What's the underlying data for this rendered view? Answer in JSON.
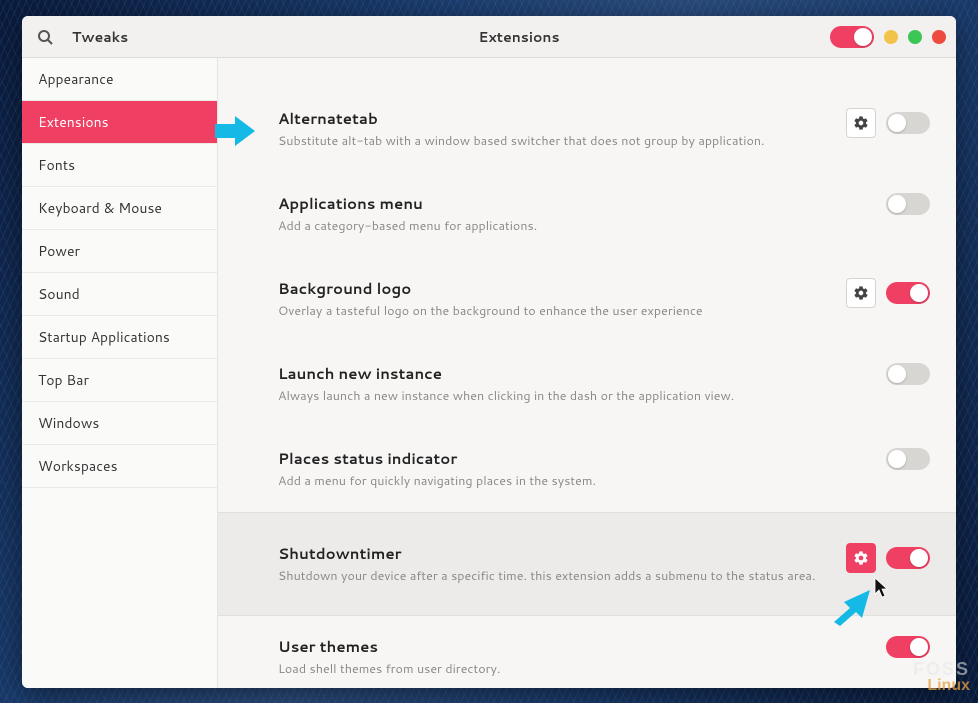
{
  "header": {
    "app_title": "Tweaks",
    "page_title": "Extensions",
    "master_toggle_on": true
  },
  "sidebar": {
    "items": [
      {
        "label": "Appearance",
        "active": false
      },
      {
        "label": "Extensions",
        "active": true
      },
      {
        "label": "Fonts",
        "active": false
      },
      {
        "label": "Keyboard & Mouse",
        "active": false
      },
      {
        "label": "Power",
        "active": false
      },
      {
        "label": "Sound",
        "active": false
      },
      {
        "label": "Startup Applications",
        "active": false
      },
      {
        "label": "Top Bar",
        "active": false
      },
      {
        "label": "Windows",
        "active": false
      },
      {
        "label": "Workspaces",
        "active": false
      }
    ]
  },
  "extensions": [
    {
      "title": "Alternatetab",
      "desc": "Substitute alt-tab with a window based switcher that does not group by application.",
      "has_settings": true,
      "settings_active": false,
      "enabled": false,
      "highlight": false
    },
    {
      "title": "Applications menu",
      "desc": "Add a category-based menu for applications.",
      "has_settings": false,
      "settings_active": false,
      "enabled": false,
      "highlight": false
    },
    {
      "title": "Background logo",
      "desc": "Overlay a tasteful logo on the background to enhance the user experience",
      "has_settings": true,
      "settings_active": false,
      "enabled": true,
      "highlight": false
    },
    {
      "title": "Launch new instance",
      "desc": "Always launch a new instance when clicking in the dash or the application view.",
      "has_settings": false,
      "settings_active": false,
      "enabled": false,
      "highlight": false
    },
    {
      "title": "Places status indicator",
      "desc": "Add a menu for quickly navigating places in the system.",
      "has_settings": false,
      "settings_active": false,
      "enabled": false,
      "highlight": false
    },
    {
      "title": "Shutdowntimer",
      "desc": "Shutdown your device after a specific time. this extension adds a submenu to the status area.",
      "has_settings": true,
      "settings_active": true,
      "enabled": true,
      "highlight": true
    },
    {
      "title": "User themes",
      "desc": "Load shell themes from user directory.",
      "has_settings": false,
      "settings_active": false,
      "enabled": true,
      "highlight": false
    }
  ],
  "watermark": {
    "line1": "FOSS",
    "line2": "Linux"
  },
  "colors": {
    "accent": "#ef4063",
    "annotation": "#15b9e6"
  }
}
